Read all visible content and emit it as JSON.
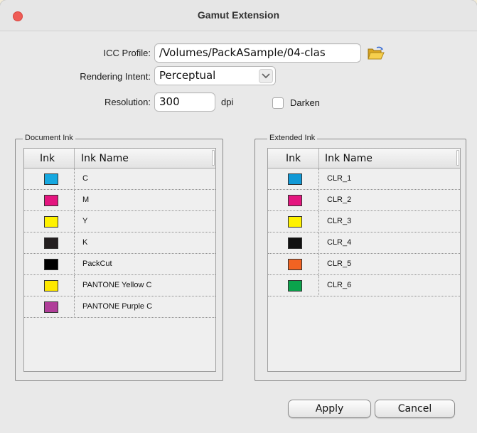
{
  "window": {
    "title": "Gamut Extension"
  },
  "form": {
    "icc_profile_label": "ICC Profile:",
    "icc_profile_value": "/Volumes/PackASample/04-clas",
    "rendering_intent_label": "Rendering Intent:",
    "rendering_intent_value": "Perceptual",
    "resolution_label": "Resolution:",
    "resolution_value": "300",
    "resolution_unit": "dpi",
    "darken_label": "Darken",
    "darken_checked": false
  },
  "document_ink": {
    "group_title": "Document Ink",
    "col_ink": "Ink",
    "col_name": "Ink Name",
    "rows": [
      {
        "name": "C",
        "color": "#16a8e0"
      },
      {
        "name": "M",
        "color": "#e4157f"
      },
      {
        "name": "Y",
        "color": "#fff200"
      },
      {
        "name": "K",
        "color": "#231f20"
      },
      {
        "name": "PackCut",
        "color": "#000000"
      },
      {
        "name": "PANTONE Yellow C",
        "color": "#fee800"
      },
      {
        "name": "PANTONE Purple C",
        "color": "#b03e99"
      }
    ]
  },
  "extended_ink": {
    "group_title": "Extended Ink",
    "col_ink": "Ink",
    "col_name": "Ink Name",
    "rows": [
      {
        "name": "CLR_1",
        "color": "#1199d6"
      },
      {
        "name": "CLR_2",
        "color": "#e4157f"
      },
      {
        "name": "CLR_3",
        "color": "#fff200"
      },
      {
        "name": "CLR_4",
        "color": "#111111"
      },
      {
        "name": "CLR_5",
        "color": "#f26322"
      },
      {
        "name": "CLR_6",
        "color": "#0ba34c"
      }
    ]
  },
  "buttons": {
    "apply": "Apply",
    "cancel": "Cancel"
  }
}
